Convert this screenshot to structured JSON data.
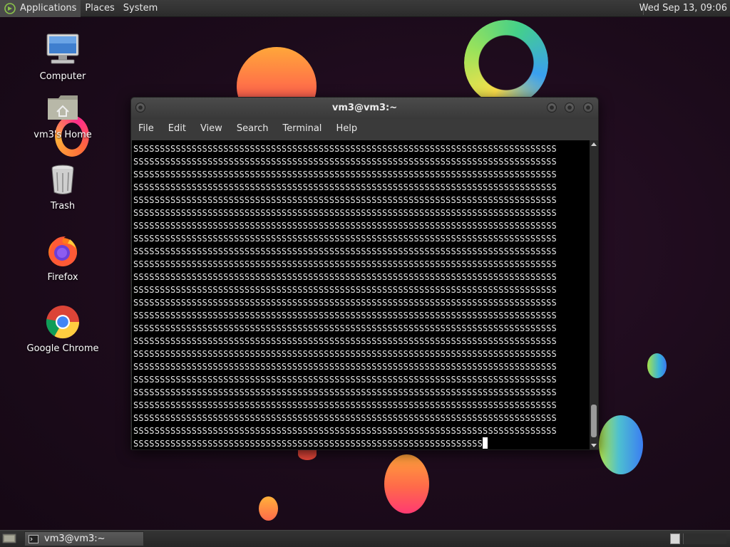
{
  "top_panel": {
    "menus": [
      "Applications",
      "Places",
      "System"
    ],
    "clock": "Wed Sep 13, 09:06"
  },
  "desktop_icons": [
    {
      "label": "Computer",
      "icon": "computer-icon"
    },
    {
      "label": "vm3's Home",
      "icon": "home-folder-icon"
    },
    {
      "label": "Trash",
      "icon": "trash-icon"
    },
    {
      "label": "Firefox",
      "icon": "firefox-icon"
    },
    {
      "label": "Google Chrome",
      "icon": "chrome-icon"
    }
  ],
  "terminal": {
    "title": "vm3@vm3:~",
    "menus": [
      "File",
      "Edit",
      "View",
      "Search",
      "Terminal",
      "Help"
    ],
    "line_text": "SSSSSSSSSSSSSSSSSSSSSSSSSSSSSSSSSSSSSSSSSSSSSSSSSSSSSSSSSSSSSSSSSSSSSSSSSSSSSSSS",
    "full_lines": 23,
    "last_line": "SSSSSSSSSSSSSSSSSSSSSSSSSSSSSSSSSSSSSSSSSSSSSSSSSSSSSSSSSSSSSSSSSS",
    "scroll_position": 0.97
  },
  "taskbar": {
    "tasks": [
      {
        "label": "vm3@vm3:~",
        "icon": "terminal-icon"
      }
    ]
  },
  "colors": {
    "desktop_bg": "#1c0b1b",
    "panel_bg": "#2b2b2b",
    "terminal_bg": "#000000",
    "terminal_fg": "#e8e8e8"
  }
}
